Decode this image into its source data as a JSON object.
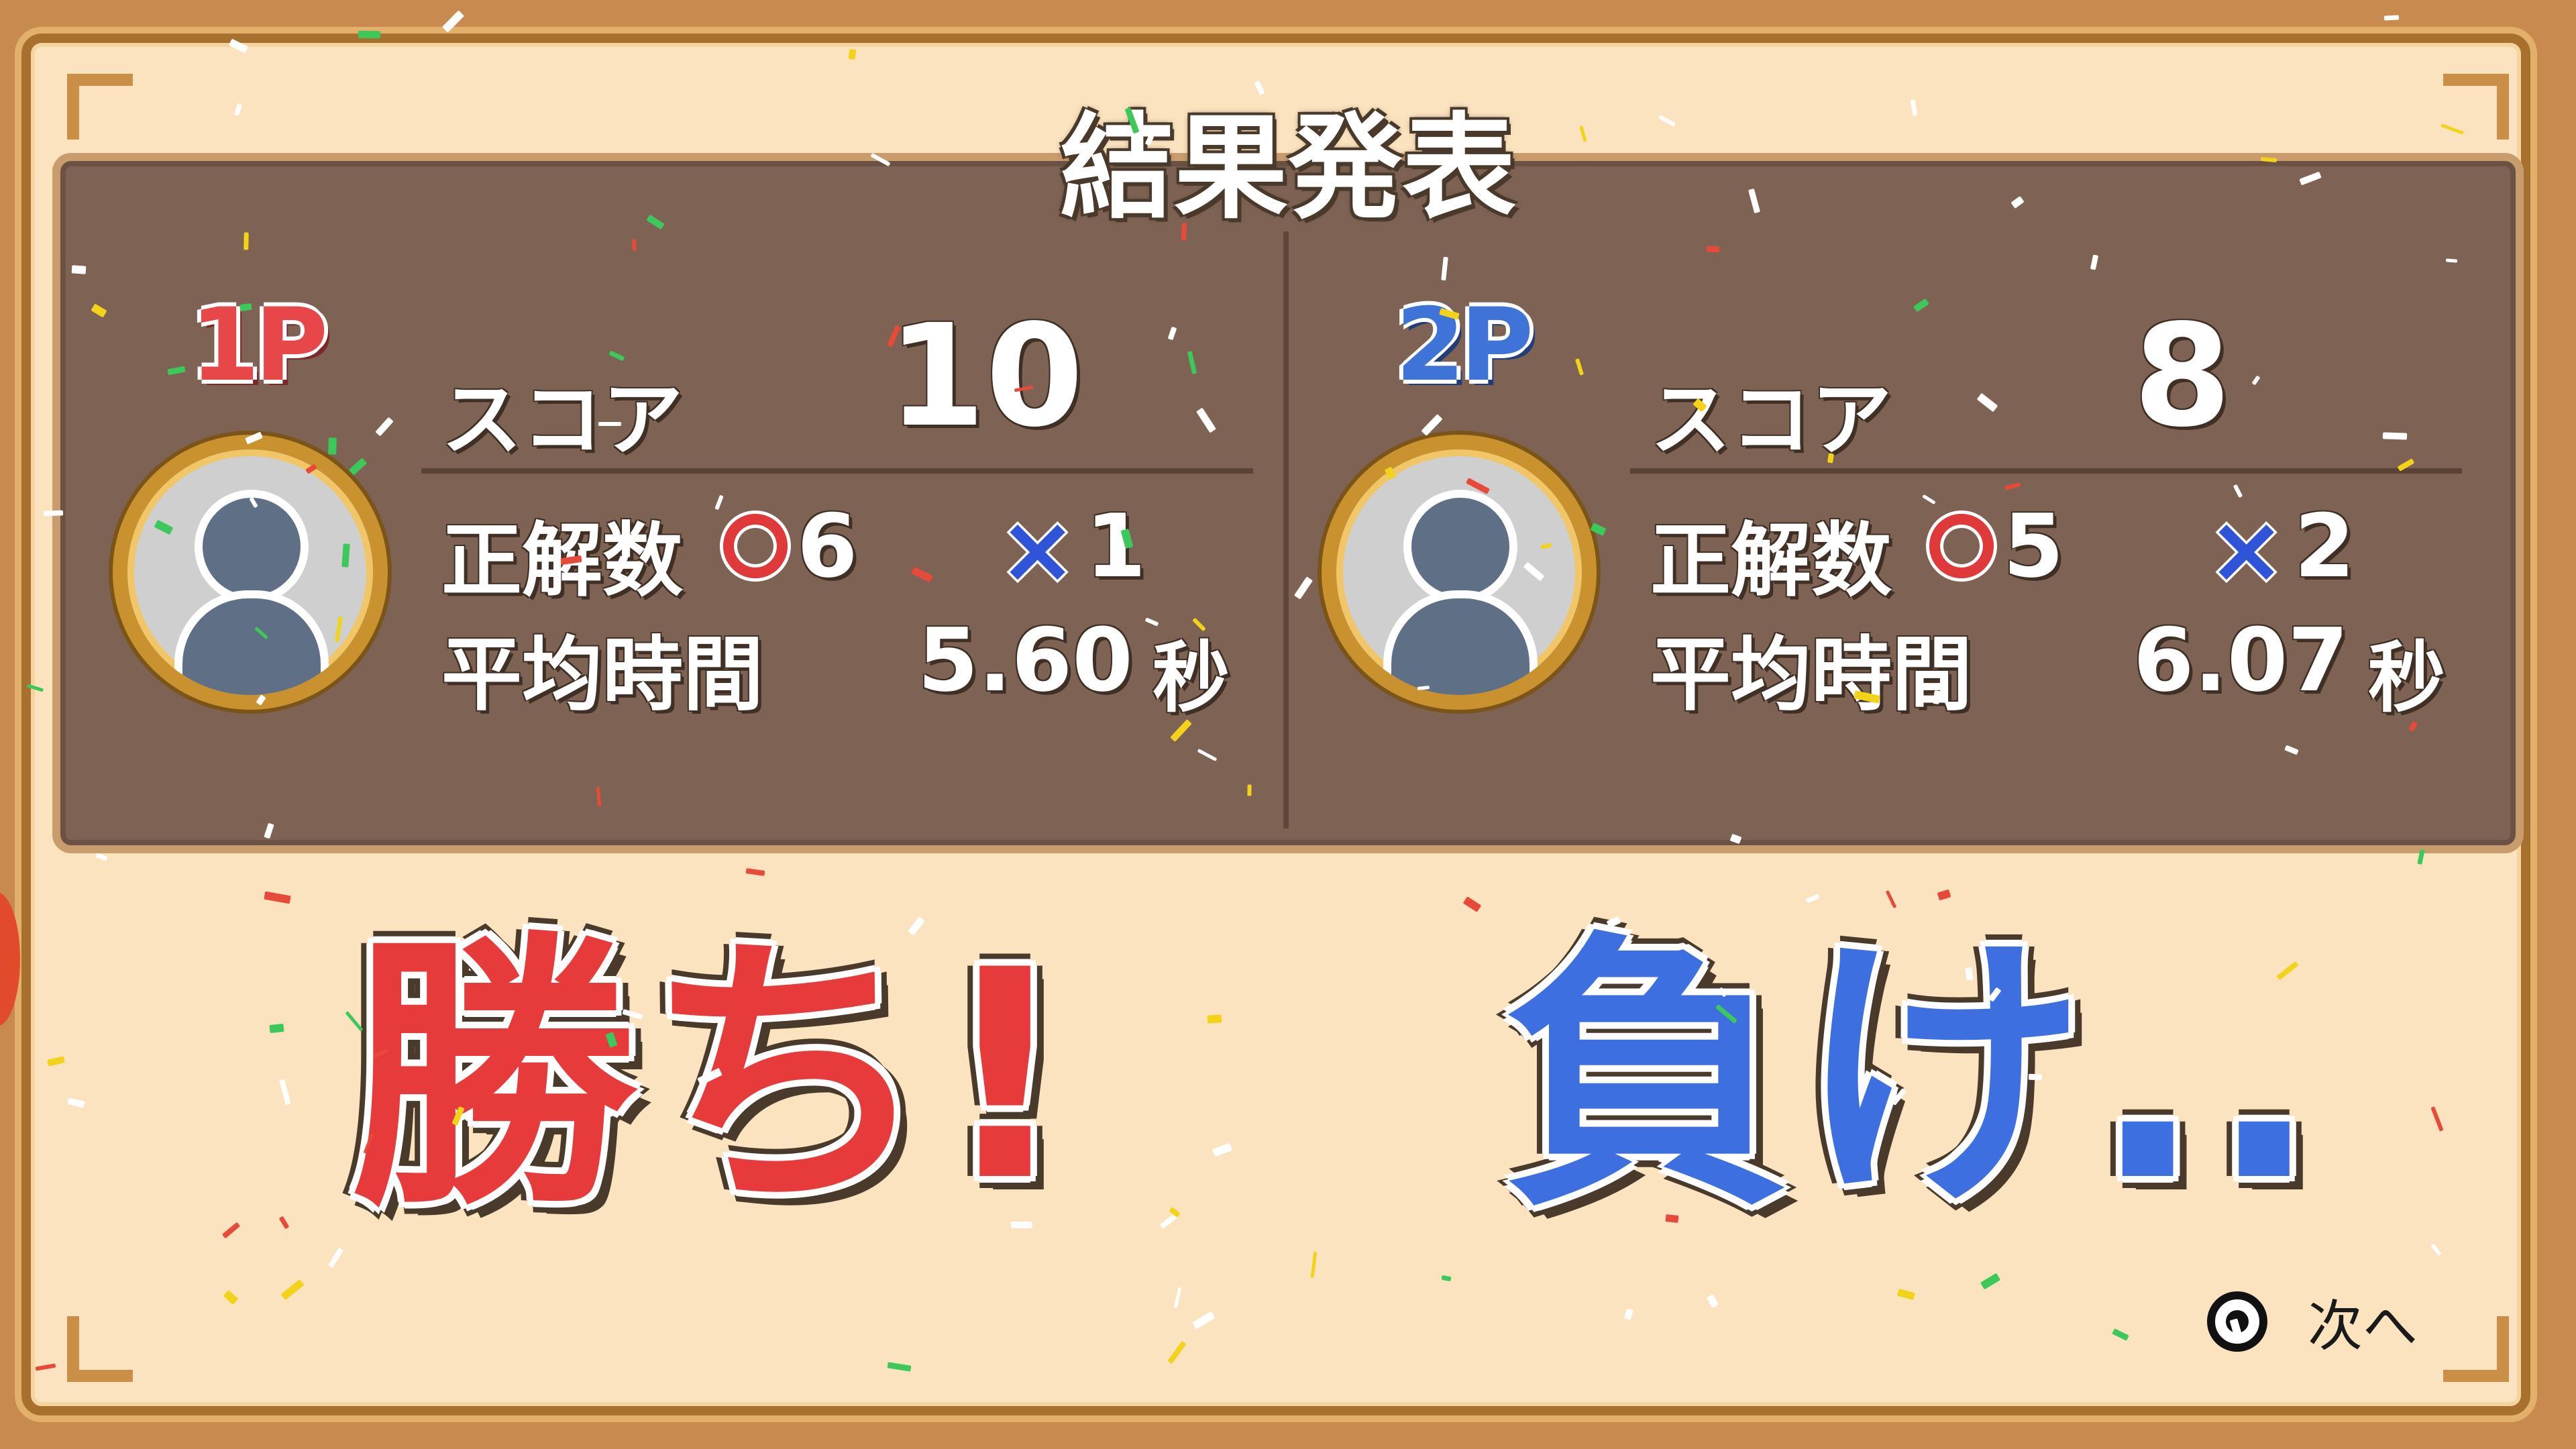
{
  "title": "結果発表",
  "players": [
    {
      "tag": "1P",
      "score_label": "スコア",
      "score": "10",
      "correct_label": "正解数",
      "correct_count": "6",
      "wrong_mark": "×",
      "wrong_count": "1",
      "time_label": "平均時間",
      "avg_time": "5.60",
      "time_unit": "秒"
    },
    {
      "tag": "2P",
      "score_label": "スコア",
      "score": "8",
      "correct_label": "正解数",
      "correct_count": "5",
      "wrong_mark": "×",
      "wrong_count": "2",
      "time_label": "平均時間",
      "avg_time": "6.07",
      "time_unit": "秒"
    }
  ],
  "results": {
    "p1": "勝ち!",
    "p2": "負け.."
  },
  "next_prompt": {
    "icon": "a-button-icon",
    "label": "次へ"
  },
  "colors": {
    "p1": "#e8474a",
    "p2": "#3f73d8",
    "panel": "#7e6354",
    "background": "#fbe3bf"
  }
}
